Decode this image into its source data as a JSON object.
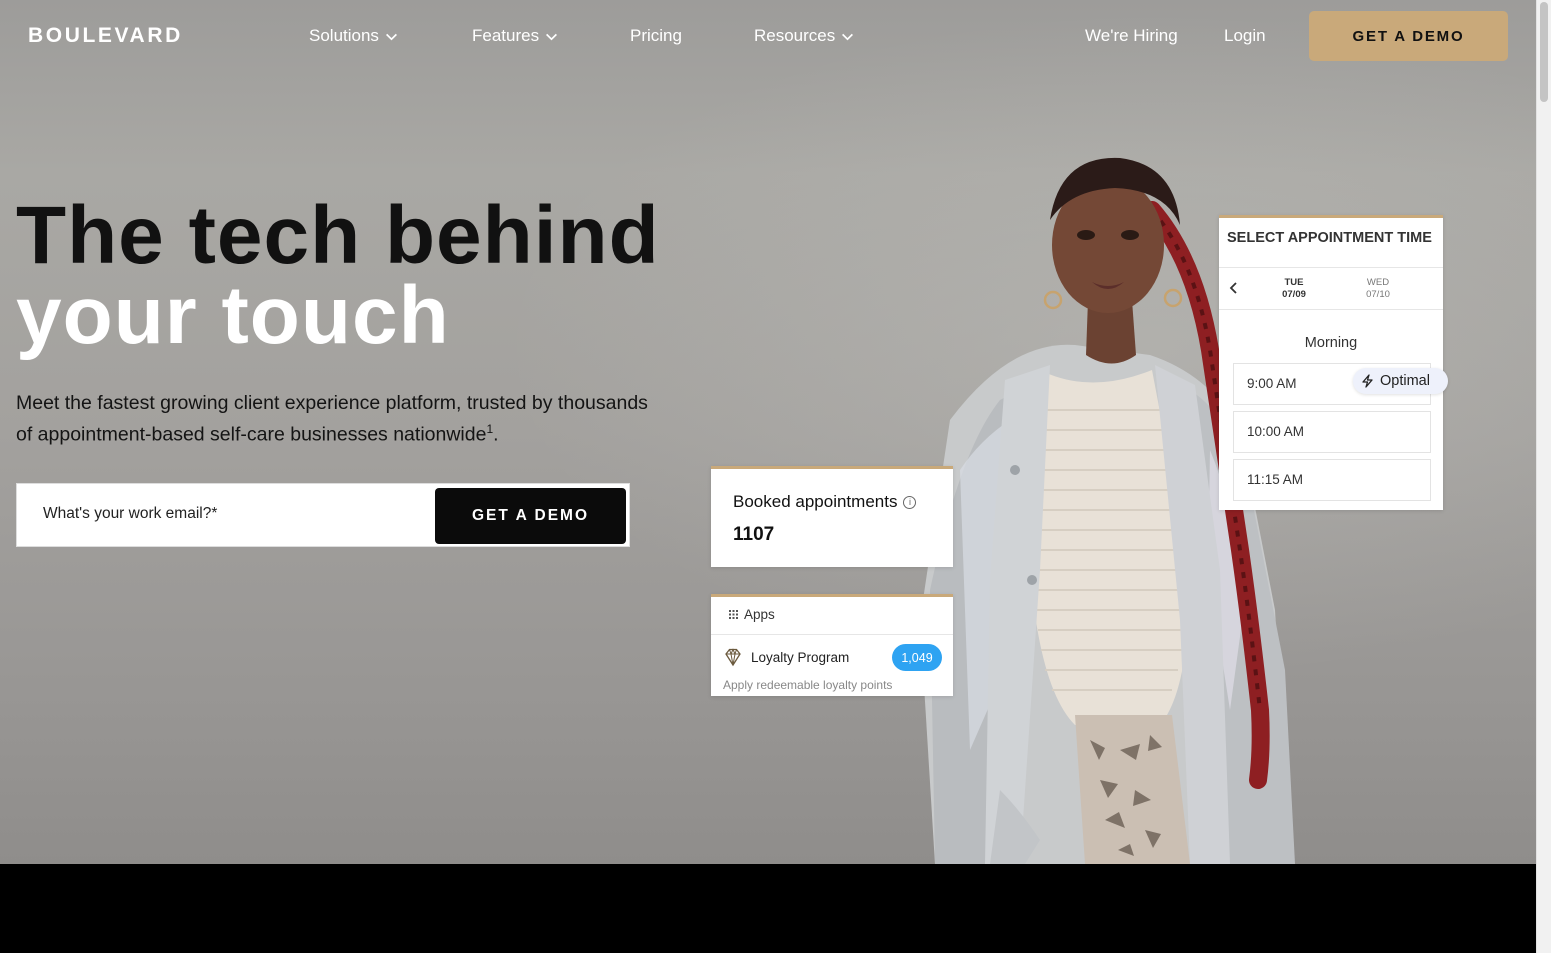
{
  "brand": {
    "logo": "BOULEVARD",
    "accent_color": "#c9a97a"
  },
  "nav": {
    "items": [
      {
        "label": "Solutions",
        "has_dropdown": true
      },
      {
        "label": "Features",
        "has_dropdown": true
      },
      {
        "label": "Pricing",
        "has_dropdown": false
      },
      {
        "label": "Resources",
        "has_dropdown": true
      }
    ],
    "hiring": "We're Hiring",
    "login": "Login",
    "cta": "GET A DEMO"
  },
  "hero": {
    "headline_line1": "The tech behind",
    "headline_line2": "your touch",
    "subtext": "Meet the fastest growing client experience platform, trusted by thousands of appointment-based self-care businesses nationwide",
    "footnote": "1",
    "subtext_end": ".",
    "email_placeholder": "What's your work email?*",
    "form_cta": "GET A DEMO"
  },
  "booked_card": {
    "label": "Booked appointments",
    "value": "1107"
  },
  "apps_card": {
    "header": "Apps",
    "item_title": "Loyalty Program",
    "item_count": "1,049",
    "item_desc": "Apply redeemable loyalty points",
    "badge_color": "#2ea3f2"
  },
  "appointment_card": {
    "title": "SELECT APPOINTMENT TIME",
    "days": [
      {
        "dow": "TUE",
        "date": "07/09",
        "selected": true
      },
      {
        "dow": "WED",
        "date": "07/10",
        "selected": false
      }
    ],
    "period": "Morning",
    "slots": [
      "9:00 AM",
      "10:00 AM",
      "11:15 AM"
    ],
    "optimal_label": "Optimal"
  }
}
